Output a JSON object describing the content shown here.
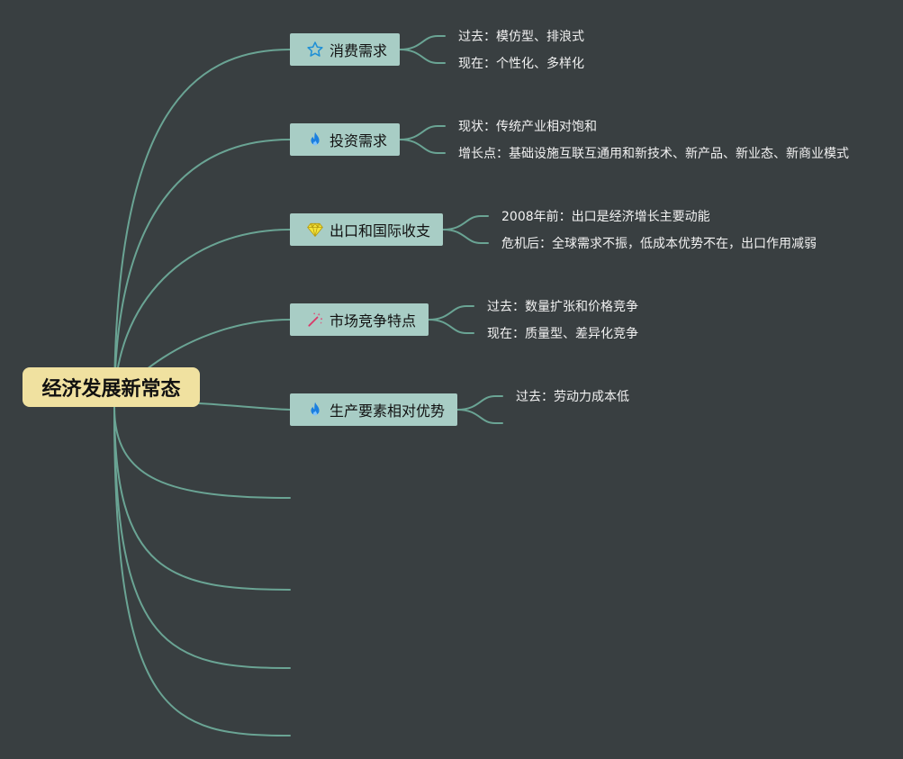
{
  "root": {
    "label": "经济发展新常态"
  },
  "branches": [
    {
      "label": "消费需求",
      "icon": "star-icon",
      "leaves": [
        "过去：模仿型、排浪式",
        "现在：个性化、多样化"
      ]
    },
    {
      "label": "投资需求",
      "icon": "fire-icon",
      "leaves": [
        "现状：传统产业相对饱和",
        "增长点：基础设施互联互通用和新技术、新产品、新业态、新商业模式"
      ]
    },
    {
      "label": "出口和国际收支",
      "icon": "diamond-icon",
      "leaves": [
        "2008年前：出口是经济增长主要动能",
        "危机后：全球需求不振，低成本优势不在，出口作用减弱"
      ]
    },
    {
      "label": "市场竞争特点",
      "icon": "magic-wand-icon",
      "leaves": [
        "过去：数量扩张和价格竞争",
        "现在：质量型、差异化竞争"
      ]
    },
    {
      "label": "生产要素相对优势",
      "icon": "fire-icon",
      "leaves": [
        "过去：劳动力成本低",
        ""
      ]
    }
  ],
  "colors": {
    "background": "#393f41",
    "connector": "#6aa494",
    "root_fill": "#f0e1a0",
    "branch_fill": "#a8cdc5",
    "leaf_text": "#f2f2f2"
  }
}
